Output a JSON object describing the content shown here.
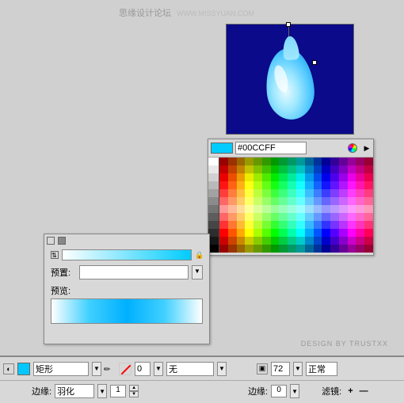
{
  "watermark": {
    "main": "思缘设计论坛",
    "sub": "WWW.MISSYUAN.COM"
  },
  "colorpicker": {
    "hex": "#00CCFF"
  },
  "gradpanel": {
    "preset_label": "预置:",
    "preview_label": "预览:"
  },
  "footer": {
    "credit": "DESIGN BY TRUSTXX",
    "shape": "矩形",
    "opacity": "0",
    "fill": "无",
    "stroke_num": "72",
    "blend": "正常",
    "edge_label": "边缘:",
    "edge_mode": "羽化",
    "edge_val": "1",
    "edge2_label": "边缘:",
    "edge2_val": "0",
    "filter_label": "滤镜:",
    "filter_add": "+",
    "filter_sub": "—"
  }
}
